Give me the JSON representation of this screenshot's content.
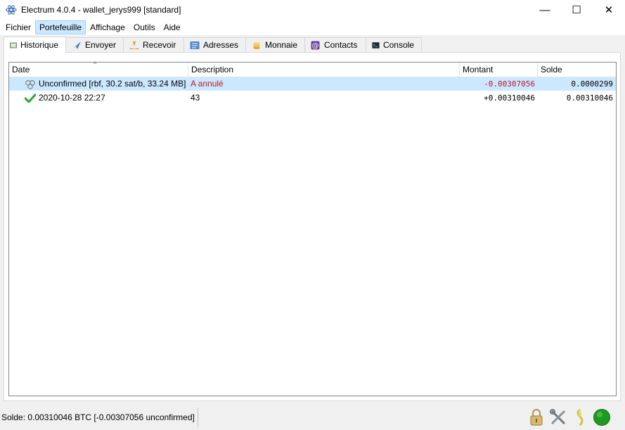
{
  "window": {
    "title": "Electrum 4.0.4  -  wallet_jerys999  [standard]",
    "minimize_glyph": "—",
    "maximize_glyph": "☐",
    "close_glyph": "✕"
  },
  "menu": [
    "Fichier",
    "Portefeuille",
    "Affichage",
    "Outils",
    "Aide"
  ],
  "menu_active": "Portefeuille",
  "tabs": [
    {
      "label": "Historique",
      "icon": "history-icon",
      "active": true
    },
    {
      "label": "Envoyer",
      "icon": "send-icon"
    },
    {
      "label": "Recevoir",
      "icon": "receive-icon"
    },
    {
      "label": "Adresses",
      "icon": "addresses-icon"
    },
    {
      "label": "Monnaie",
      "icon": "coins-icon"
    },
    {
      "label": "Contacts",
      "icon": "contacts-icon"
    },
    {
      "label": "Console",
      "icon": "console-icon"
    }
  ],
  "history": {
    "sort_indicator": "^",
    "columns": [
      "Date",
      "Description",
      "Montant",
      "Solde"
    ],
    "rows": [
      {
        "status_icon": "unconfirmed-icon",
        "date": "Unconfirmed [rbf, 30.2 sat/b, 33.24 MB]",
        "description": "A annulé",
        "amount": "-0.00307056",
        "balance": "0.0000299",
        "selected": true
      },
      {
        "status_icon": "confirmed-check-icon",
        "date": "2020-10-28 22:27",
        "description": "43",
        "amount": "+0.00310046",
        "balance": "0.00310046",
        "selected": false
      }
    ]
  },
  "status": {
    "balance_text": "Solde: 0.00310046 BTC  [-0.00307056 unconfirmed]",
    "icons": [
      "lock-icon",
      "preferences-icon",
      "seed-icon",
      "network-status-icon"
    ]
  },
  "colors": {
    "selection": "#cce8ff",
    "negative_amount": "#b3192b",
    "network_ok": "#1e9b1e"
  }
}
